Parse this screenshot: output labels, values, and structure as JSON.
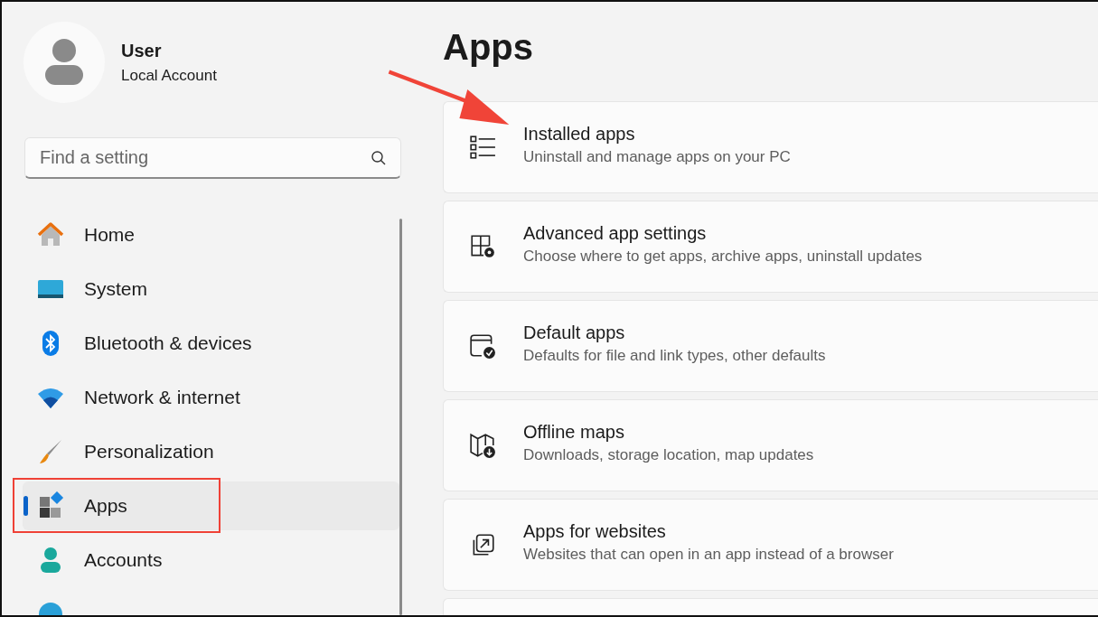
{
  "account": {
    "name": "User",
    "type": "Local Account"
  },
  "search": {
    "placeholder": "Find a setting"
  },
  "nav": [
    {
      "label": "Home",
      "selected": false
    },
    {
      "label": "System",
      "selected": false
    },
    {
      "label": "Bluetooth & devices",
      "selected": false
    },
    {
      "label": "Network & internet",
      "selected": false
    },
    {
      "label": "Personalization",
      "selected": false
    },
    {
      "label": "Apps",
      "selected": true
    },
    {
      "label": "Accounts",
      "selected": false
    }
  ],
  "page_title": "Apps",
  "cards": [
    {
      "title": "Installed apps",
      "description": "Uninstall and manage apps on your PC"
    },
    {
      "title": "Advanced app settings",
      "description": "Choose where to get apps, archive apps, uninstall updates"
    },
    {
      "title": "Default apps",
      "description": "Defaults for file and link types, other defaults"
    },
    {
      "title": "Offline maps",
      "description": "Downloads, storage location, map updates"
    },
    {
      "title": "Apps for websites",
      "description": "Websites that can open in an app instead of a browser"
    }
  ]
}
